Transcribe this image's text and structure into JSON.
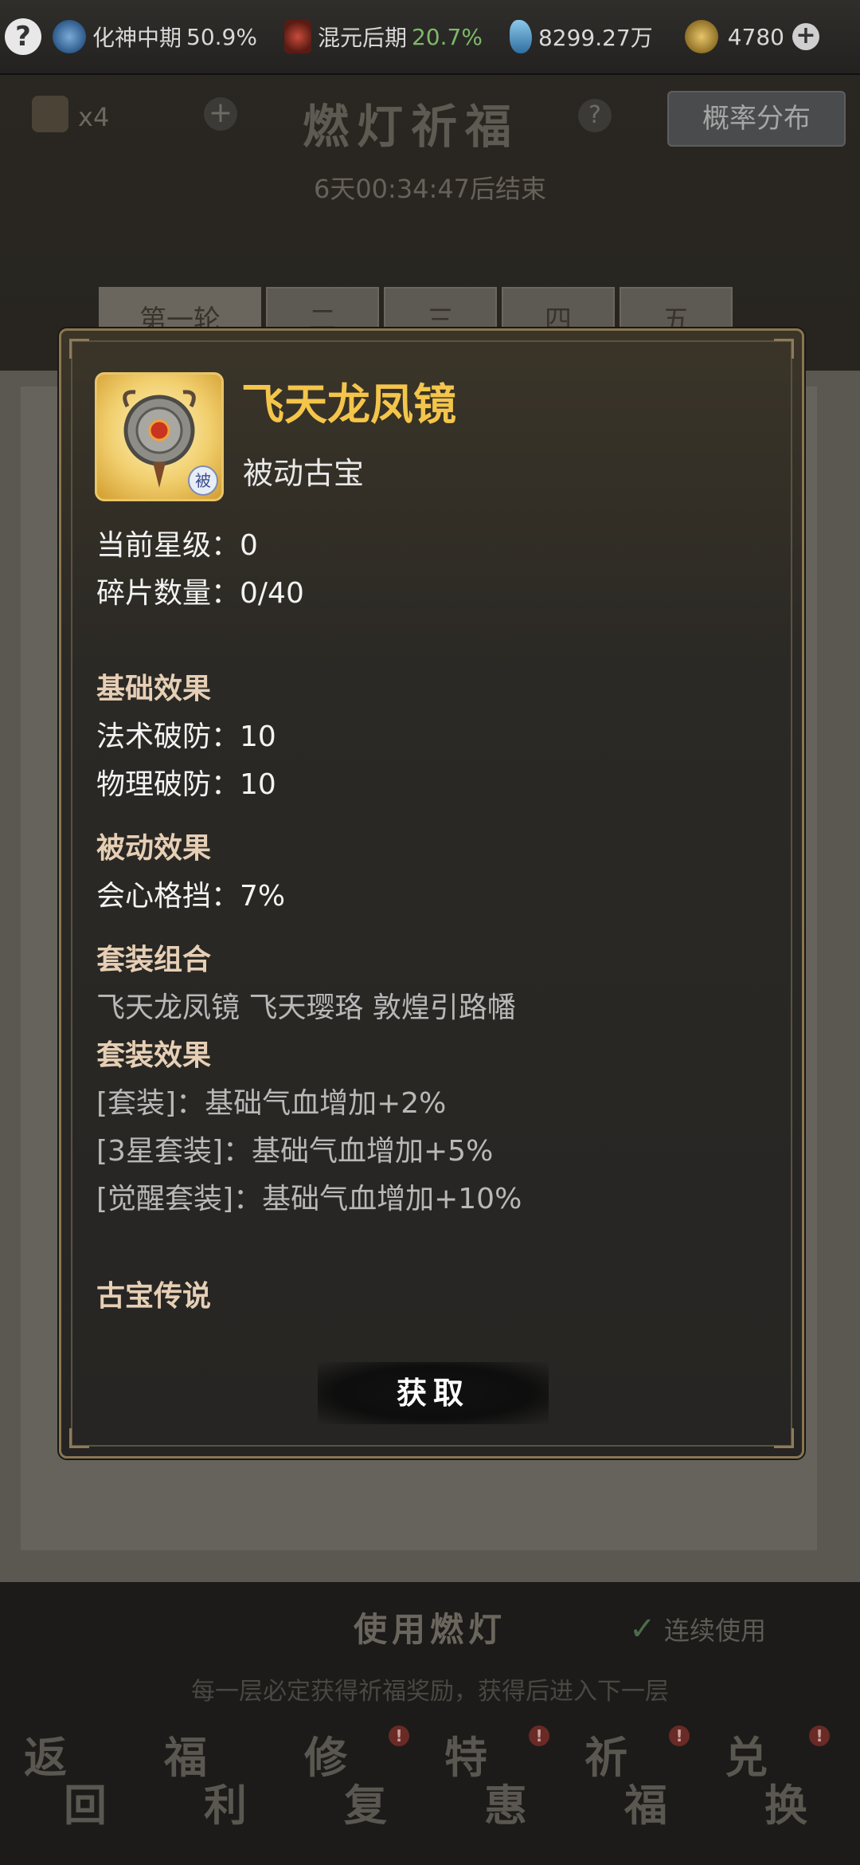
{
  "topbar": {
    "help_icon": "question-circle-icon",
    "res1_label": "化神中期",
    "res1_pct": "50.9%",
    "res2_label": "混元后期",
    "res2_pct": "20.7%",
    "res3_value": "8299.27万",
    "res4_value": "4780"
  },
  "header": {
    "count": "x4",
    "title": "燃灯祈福",
    "prob_button": "概率分布",
    "timer": "6天00:34:47后结束"
  },
  "tabs": [
    "第一轮",
    "二",
    "三",
    "四",
    "五"
  ],
  "modal": {
    "item_name": "飞天龙凤镜",
    "item_type": "被动古宝",
    "badge": "被",
    "star_label": "当前星级：",
    "star_value": "0",
    "frag_label": "碎片数量：",
    "frag_value": "0/40",
    "base_title": "基础效果",
    "base_1_label": "法术破防：",
    "base_1_value": "10",
    "base_2_label": "物理破防：",
    "base_2_value": "10",
    "passive_title": "被动效果",
    "passive_1_label": "会心格挡：",
    "passive_1_value": "7%",
    "set_combo_title": "套装组合",
    "set_combo_items": "飞天龙凤镜 飞天璎珞 敦煌引路幡",
    "set_effect_title": "套装效果",
    "set_effect_1": "[套装]：基础气血增加+2%",
    "set_effect_2": "[3星套装]：基础气血增加+5%",
    "set_effect_3": "[觉醒套装]：基础气血增加+10%",
    "legend_title": "古宝传说",
    "get_button": "获取"
  },
  "bottom": {
    "use_button": "使用燃灯",
    "continuous": "连续使用",
    "hint": "每一层必定获得祈福奖励，获得后进入下一层",
    "navs": [
      {
        "c1": "返",
        "c2": "回",
        "dot": ""
      },
      {
        "c1": "福",
        "c2": "利",
        "dot": ""
      },
      {
        "c1": "修",
        "c2": "复",
        "dot": "!"
      },
      {
        "c1": "特",
        "c2": "惠",
        "dot": "!"
      },
      {
        "c1": "祈",
        "c2": "福",
        "dot": "!"
      },
      {
        "c1": "兑",
        "c2": "换",
        "dot": "!"
      }
    ]
  }
}
